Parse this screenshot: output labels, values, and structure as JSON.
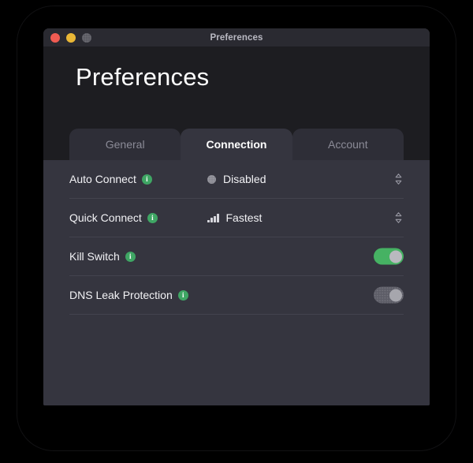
{
  "window": {
    "titlebar_title": "Preferences",
    "traffic_lights": [
      {
        "name": "close",
        "color": "#f05b52"
      },
      {
        "name": "minimize",
        "color": "#e9b736"
      },
      {
        "name": "zoom",
        "color": "#5b5b63"
      }
    ]
  },
  "header": {
    "page_title": "Preferences"
  },
  "tabs": [
    {
      "label": "General",
      "active": false
    },
    {
      "label": "Connection",
      "active": true
    },
    {
      "label": "Account",
      "active": false
    }
  ],
  "settings": [
    {
      "label": "Auto Connect",
      "info_icon": "info-icon",
      "control": "select",
      "value": "Disabled",
      "value_icon": "status-dot-icon",
      "stepper_icon": "chevron-up-down-icon"
    },
    {
      "label": "Quick Connect",
      "info_icon": "info-icon",
      "control": "select",
      "value": "Fastest",
      "value_icon": "signal-bars-icon",
      "stepper_icon": "chevron-up-down-icon"
    },
    {
      "label": "Kill Switch",
      "info_icon": "info-icon",
      "control": "toggle",
      "value": "on"
    },
    {
      "label": "DNS Leak Protection",
      "info_icon": "info-icon",
      "control": "toggle",
      "value": "off"
    }
  ],
  "colors": {
    "accent_green": "#46b263",
    "info_green": "#3fa664",
    "panel_bg": "#35353f",
    "header_bg": "#1d1d21",
    "titlebar_bg": "#2a2a31",
    "tab_inactive_bg": "#2e2e37",
    "divider": "#43434e",
    "text_primary": "#f2f2f5",
    "text_muted": "#8b8b97",
    "desktop_bg": "#000000"
  }
}
